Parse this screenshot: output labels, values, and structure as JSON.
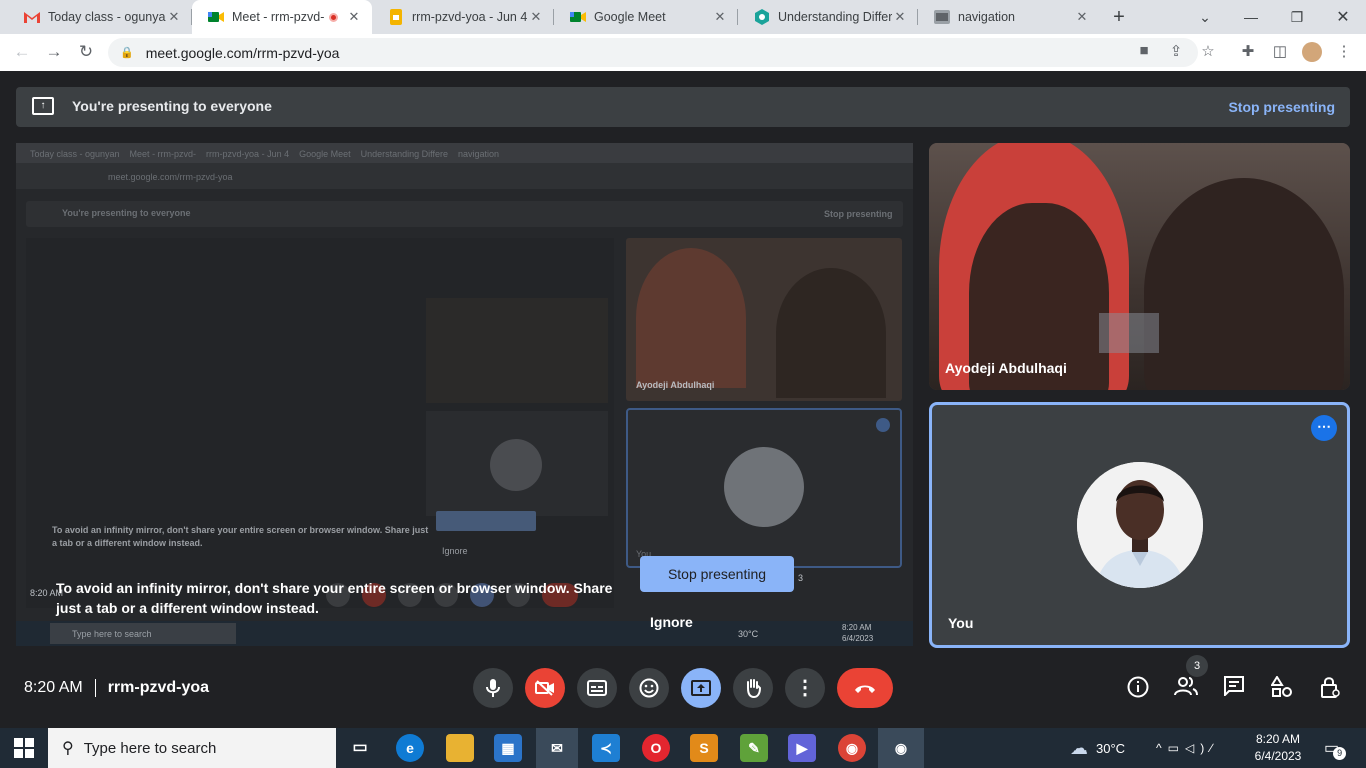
{
  "browser": {
    "tabs": [
      {
        "title": "Today class - ogunyan",
        "icon": "gmail-icon"
      },
      {
        "title": "Meet - rrm-pzvd-",
        "icon": "meet-icon",
        "recording": true
      },
      {
        "title": "rrm-pzvd-yoa - Jun 4,",
        "icon": "slides-icon"
      },
      {
        "title": "Google Meet",
        "icon": "meet-icon"
      },
      {
        "title": "Understanding Differe",
        "icon": "site-icon"
      },
      {
        "title": "navigation",
        "icon": "page-icon"
      }
    ],
    "new_tab": "+",
    "url": "meet.google.com/rrm-pzvd-yoa"
  },
  "banner": {
    "text": "You're presenting to everyone",
    "stop_label": "Stop presenting"
  },
  "share_preview": {
    "mirror_tabs": "Today class - ogunyan    Meet - rrm-pzvd-    rrm-pzvd-yoa - Jun 4    Google Meet    Understanding Differe    navigation",
    "mirror_url": "meet.google.com/rrm-pzvd-yoa",
    "mirror_banner": "You're presenting to everyone",
    "mirror_stop": "Stop presenting",
    "mirror_name": "Ayodeji Abdulhaqi",
    "mirror_you": "You",
    "mirror_warning": "To avoid an infinity mirror, don't share your entire screen or browser window. Share just a tab or a different window instead.",
    "mirror_ignore": "Ignore",
    "mirror_time": "8:20 AM",
    "mirror_search": "Type here to search",
    "mirror_weather": "30°C",
    "mirror_clock": "8:20 AM",
    "mirror_date": "6/4/2023",
    "mirror_badge": "3"
  },
  "warning": {
    "text": "To avoid an infinity mirror, don't share your entire screen or browser window. Share just a tab or a different window instead.",
    "stop_label": "Stop presenting",
    "ignore_label": "Ignore"
  },
  "participants": [
    {
      "name": "Ayodeji Abdulhaqi"
    },
    {
      "name": "You"
    }
  ],
  "controls": {
    "time": "8:20 AM",
    "meeting_code": "rrm-pzvd-yoa",
    "people_count": "3"
  },
  "taskbar": {
    "search_placeholder": "Type here to search",
    "weather": "30°C",
    "clock_time": "8:20 AM",
    "clock_date": "6/4/2023",
    "notification_count": "9"
  },
  "colors": {
    "meet_bg": "#202124",
    "accent_blue": "#8ab4f8",
    "danger_red": "#ea4335",
    "banner_bg": "#3c4043"
  }
}
